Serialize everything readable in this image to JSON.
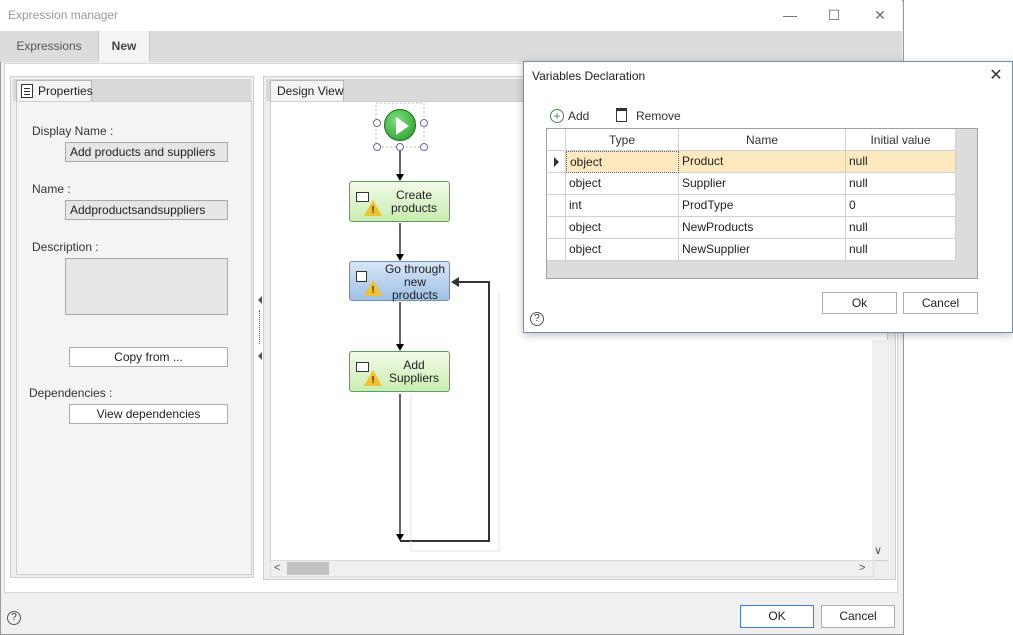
{
  "window": {
    "title": "Expression manager",
    "minimize_glyph": "—",
    "maximize_glyph": "☐",
    "close_glyph": "✕"
  },
  "tabs": [
    {
      "label": "Expressions",
      "active": false
    },
    {
      "label": "New",
      "active": true
    }
  ],
  "properties": {
    "tab_label": "Properties",
    "display_name_label": "Display Name :",
    "display_name_value": "Add products and suppliers",
    "name_label": "Name :",
    "name_value": "Addproductsandsuppliers",
    "description_label": "Description :",
    "description_value": "",
    "copy_from_label": "Copy from ...",
    "dependencies_label": "Dependencies :",
    "view_dependencies_label": "View dependencies"
  },
  "design_view": {
    "tab_label": "Design View",
    "nodes": [
      {
        "label_lines": [
          "Create",
          "products"
        ],
        "kind": "activity",
        "warning": true
      },
      {
        "label_lines": [
          "Go through",
          "new",
          "products"
        ],
        "kind": "loop",
        "warning": true
      },
      {
        "label_lines": [
          "Add",
          "Suppliers"
        ],
        "kind": "activity",
        "warning": true
      }
    ],
    "scroll_left_glyph": "<",
    "scroll_right_glyph": ">",
    "scroll_down_glyph": "∨"
  },
  "footer": {
    "help_glyph": "?",
    "ok_label": "OK",
    "cancel_label": "Cancel"
  },
  "dialog": {
    "title": "Variables Declaration",
    "close_glyph": "✕",
    "add_label": "Add",
    "remove_label": "Remove",
    "columns": [
      "Type",
      "Name",
      "Initial value"
    ],
    "rows": [
      {
        "type": "object",
        "name": "Product",
        "initial": "null",
        "selected": true
      },
      {
        "type": "object",
        "name": "Supplier",
        "initial": "null",
        "selected": false
      },
      {
        "type": "int",
        "name": "ProdType",
        "initial": "0",
        "selected": false
      },
      {
        "type": "object",
        "name": "NewProducts",
        "initial": "null",
        "selected": false
      },
      {
        "type": "object",
        "name": "NewSupplier",
        "initial": "null",
        "selected": false
      }
    ],
    "ok_label": "Ok",
    "cancel_label": "Cancel",
    "help_glyph": "?"
  },
  "colors": {
    "activity_fill": "#d9f2c6",
    "loop_fill": "#b7d0ee",
    "selected_row": "#fde9bf",
    "start_green": "#2fb22f"
  }
}
